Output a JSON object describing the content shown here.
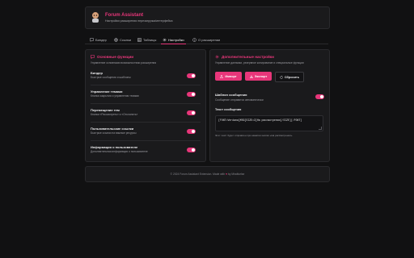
{
  "header": {
    "title": "Forum Assistant",
    "subtitle": "Настройки расширения перезагрузка/интерфейса"
  },
  "tabs": [
    {
      "label": "Биндер",
      "icon": "chat-icon",
      "active": false
    },
    {
      "label": "Ссылки",
      "icon": "globe-icon",
      "active": false
    },
    {
      "label": "Таблицы",
      "icon": "table-icon",
      "active": false
    },
    {
      "label": "Настройки",
      "icon": "gear-icon",
      "active": true
    },
    {
      "label": "О расширении",
      "icon": "info-icon",
      "active": false
    }
  ],
  "left_panel": {
    "title": "Основные функции",
    "icon": "chat-icon",
    "description": "Управление основными возможностями расширения",
    "features": [
      {
        "name": "Биндер",
        "description": "Быстрые сообщения и шаблоны",
        "enabled": true
      },
      {
        "name": "Управление темами",
        "description": "Кнопки закрытия и управления темами",
        "enabled": true
      },
      {
        "name": "Перемещение тем",
        "description": "Кнопки «Рассмотреть» и «Отклонить»",
        "enabled": true
      },
      {
        "name": "Пользовательские ссылки",
        "description": "Быстрые ссылки на важные ресурсы",
        "enabled": true
      },
      {
        "name": "Информация о пользователе",
        "description": "Дополнительная информация о пользователе",
        "enabled": true
      }
    ]
  },
  "right_panel": {
    "title": "Дополнительные настройки",
    "icon": "gear-icon",
    "description": "Управление данными, резервное копирование и специальные функции",
    "buttons": {
      "import": "Импорт",
      "export": "Экспорт",
      "reset": "Сбросить"
    },
    "template": {
      "label": "Шаблон сообщения",
      "description": "Сообщение отправится автоматически",
      "enabled": true
    },
    "text_label": "Текст сообщения",
    "text_value": "[FONT=Verdana]MSG[SIZE=3]На рассмотрении[/SIZE][/FONT]",
    "hint": "Этот текст будет отправлен при нажатии кнопки «На рассмотрении»"
  },
  "footer": {
    "before_heart": "© 2024 Forum Assistant Extension. Made with",
    "heart": "♥",
    "after_heart": "by Mindfuelse"
  },
  "colors": {
    "accent": "#e8367a",
    "background": "#111112",
    "card": "#1a1a1c"
  }
}
